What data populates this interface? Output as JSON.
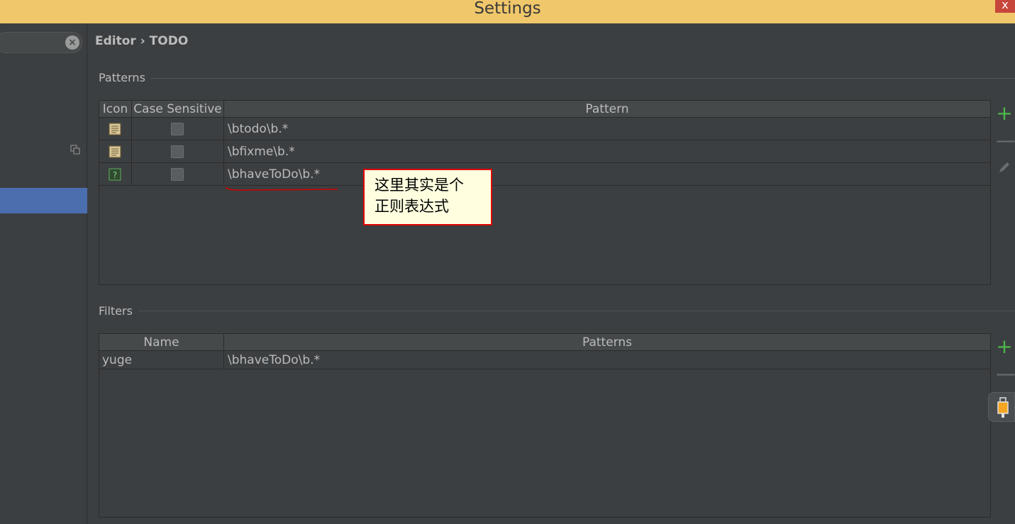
{
  "window": {
    "title": "Settings",
    "close_glyph": "x"
  },
  "sidebar": {
    "search": {
      "value": ""
    }
  },
  "breadcrumb": {
    "parent": "Editor",
    "separator": " › ",
    "current": "TODO"
  },
  "patterns": {
    "section_title": "Patterns",
    "columns": [
      "Icon",
      "Case Sensitive",
      "Pattern"
    ],
    "rows": [
      {
        "icon": "todo-doc-icon",
        "case_sensitive": false,
        "pattern": "\\btodo\\b.*"
      },
      {
        "icon": "todo-doc-icon",
        "case_sensitive": false,
        "pattern": "\\bfixme\\b.*"
      },
      {
        "icon": "question-doc-icon",
        "case_sensitive": false,
        "pattern": "\\bhaveToDo\\b.*"
      }
    ]
  },
  "filters": {
    "section_title": "Filters",
    "columns": [
      "Name",
      "Patterns"
    ],
    "rows": [
      {
        "name": "yuge",
        "patterns": "\\bhaveToDo\\b.*"
      }
    ]
  },
  "callout": {
    "line1": "这里其实是个",
    "line2": "正则表达式"
  },
  "colors": {
    "accent_selected": "#4b6eaf",
    "title_bar": "#f0c76a",
    "add_green": "#4cb849",
    "callout_border": "#e00000"
  }
}
